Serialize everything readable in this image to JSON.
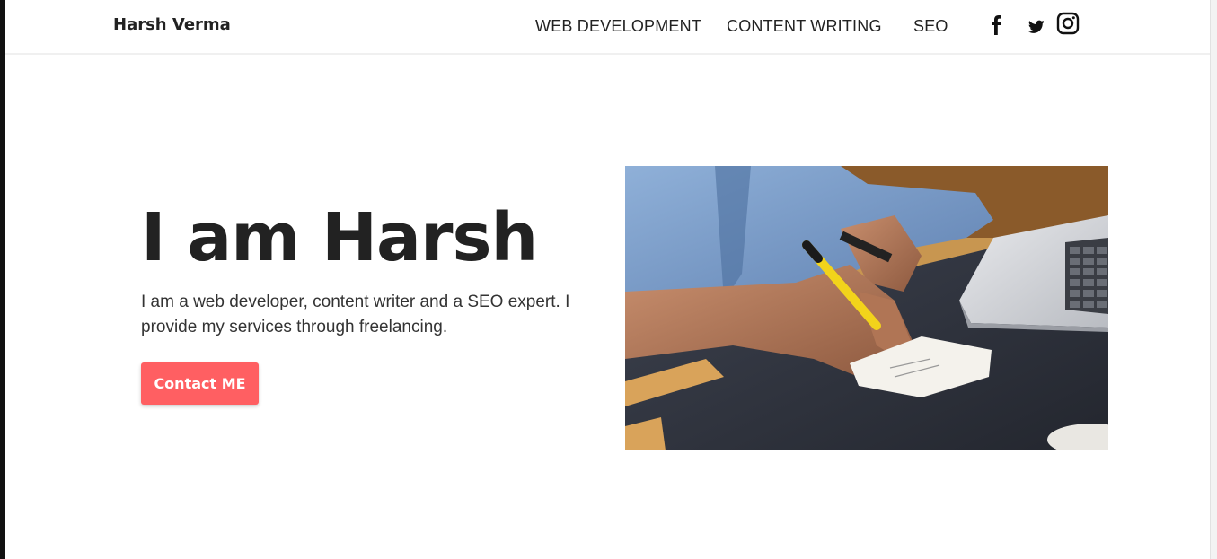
{
  "navbar": {
    "brand": "Harsh Verma",
    "links": [
      {
        "label": "WEB DEVELOPMENT"
      },
      {
        "label": "CONTENT WRITING"
      },
      {
        "label": "SEO"
      }
    ],
    "social_icons": [
      "facebook-icon",
      "twitter-icon",
      "instagram-icon"
    ]
  },
  "hero": {
    "title": "I am Harsh",
    "description": "I am a web developer, content writer and a SEO expert. I provide my services through freelancing.",
    "cta_label": "Contact ME",
    "image_subject": "hero-photo-writing-at-desk"
  },
  "colors": {
    "cta": "#ff5f62",
    "text": "#222222",
    "background": "#ffffff"
  }
}
